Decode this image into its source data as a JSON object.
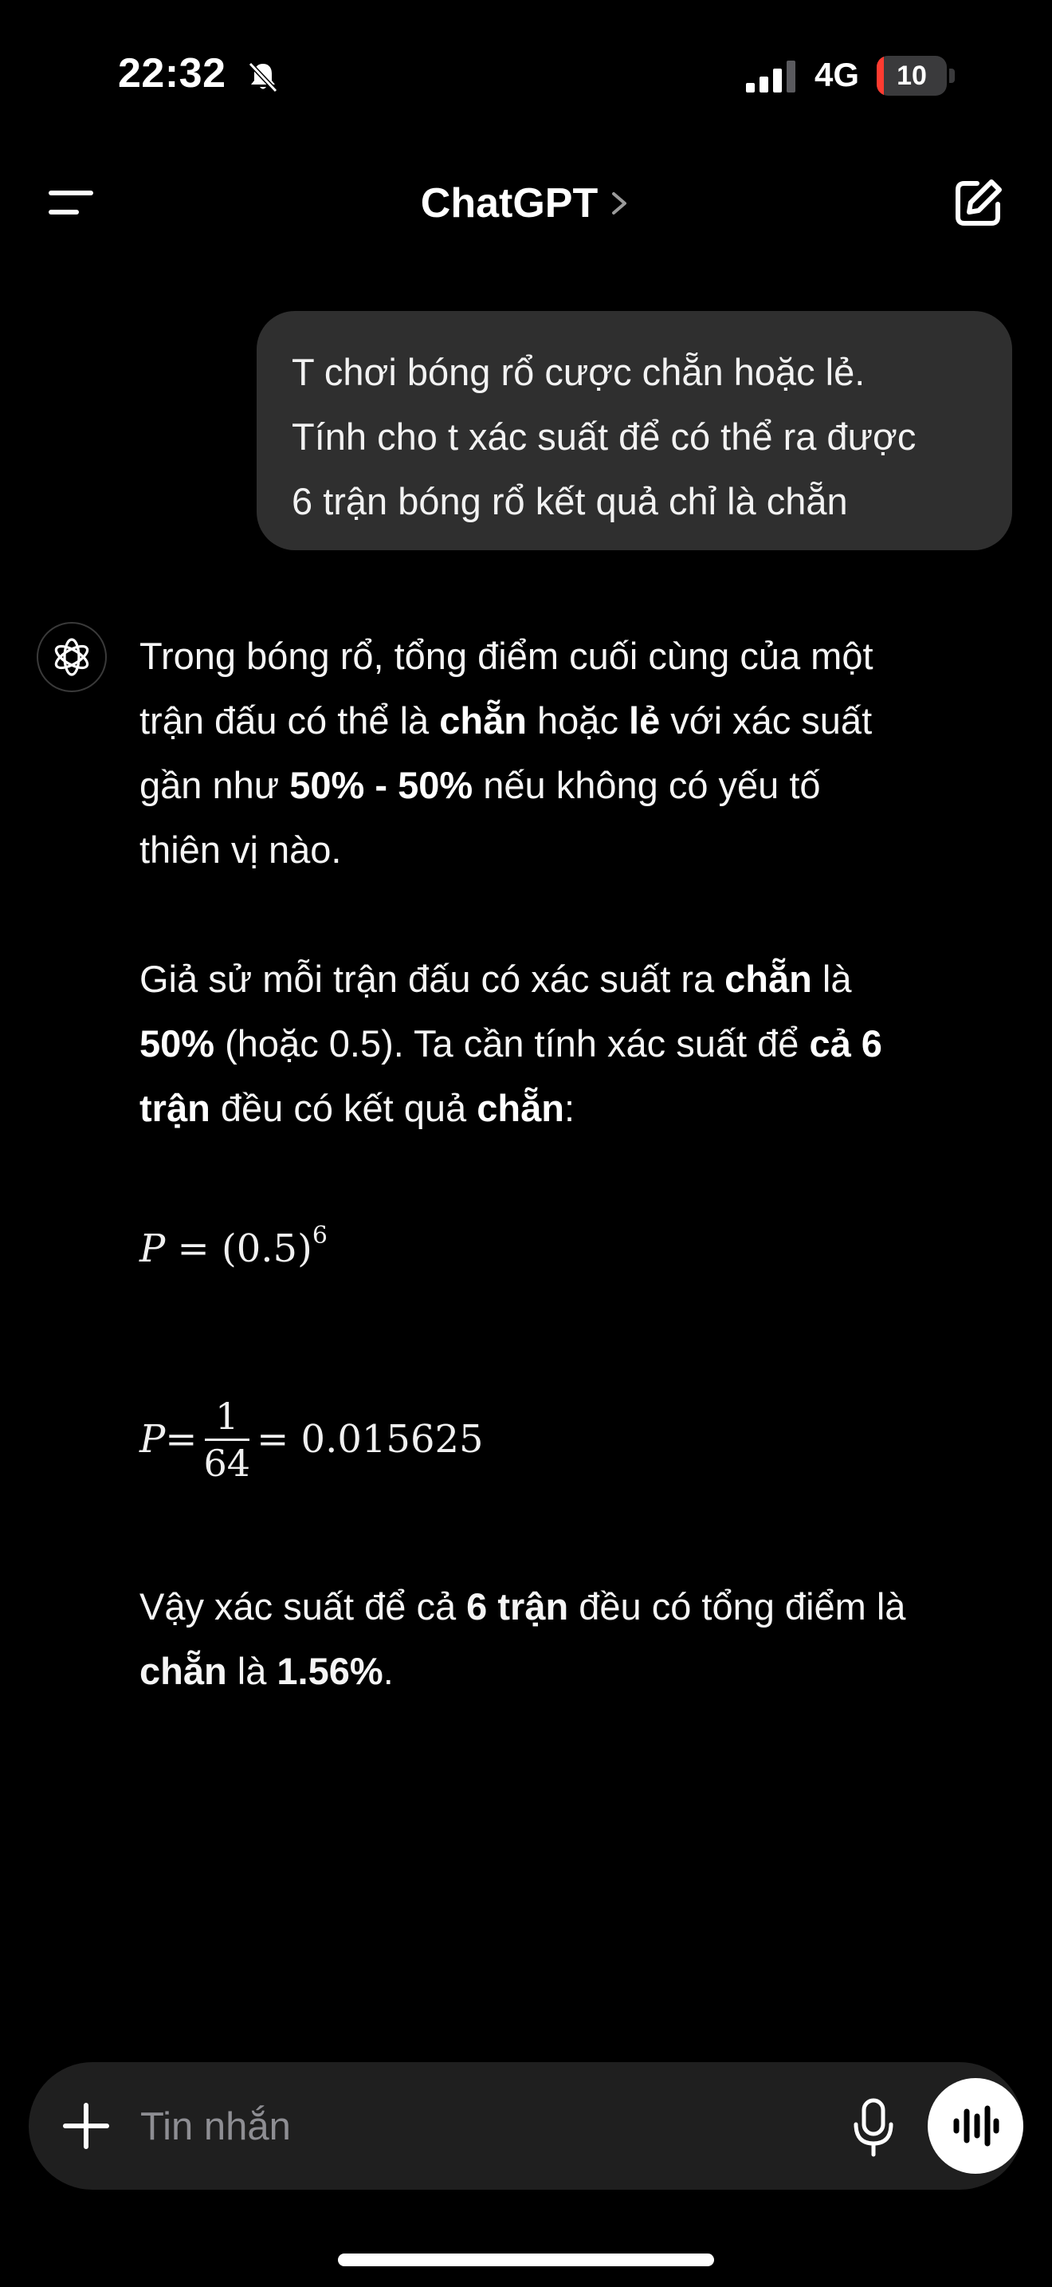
{
  "status_bar": {
    "time": "22:32",
    "network": "4G",
    "battery_level": "10",
    "battery_fraction": 0.1
  },
  "header": {
    "title": "ChatGPT"
  },
  "user_message": {
    "lines": [
      "T chơi bóng rổ cược chẵn hoặc lẻ.",
      "Tính cho t xác suất để có thể ra được",
      "6 trận bóng rổ kết quả chỉ là chẵn"
    ]
  },
  "assistant": {
    "p1": {
      "l1": "Trong bóng rổ, tổng điểm cuối cùng của một",
      "l2a": "trận đấu có thể là ",
      "l2b": "chẵn",
      "l2c": " hoặc ",
      "l2d": "lẻ",
      "l2e": " với xác suất",
      "l3a": "gần như ",
      "l3b": "50% - 50%",
      "l3c": " nếu không có yếu tố",
      "l4": "thiên vị nào."
    },
    "p2": {
      "l1a": "Giả sử mỗi trận đấu có xác suất ra ",
      "l1b": "chẵn",
      "l1c": " là",
      "l2a": "50%",
      "l2b": " (hoặc 0.5). Ta cần tính xác suất để ",
      "l2c": "cả 6",
      "l3a": "trận",
      "l3b": " đều có kết quả ",
      "l3c": "chẵn",
      "l3d": ":"
    },
    "math1": {
      "lhs": "P",
      "eq": " = (0.5)",
      "exp": "6"
    },
    "math2": {
      "lhs": "P",
      "eq": " = ",
      "num": "1",
      "den": "64",
      "rhs": " = 0.015625"
    },
    "p3": {
      "l1a": "Vậy xác suất để cả ",
      "l1b": "6 trận",
      "l1c": " đều có tổng điểm là",
      "l2a": "chẵn",
      "l2b": " là ",
      "l2c": "1.56%",
      "l2d": "."
    }
  },
  "composer": {
    "placeholder": "Tin nhắn"
  },
  "icons": {
    "menu": "menu-icon",
    "compose": "compose-icon",
    "plus": "plus-icon",
    "mic": "microphone-icon",
    "voice": "voice-mode-icon",
    "assistant": "openai-logo-icon",
    "silent": "bell-slash-icon"
  }
}
